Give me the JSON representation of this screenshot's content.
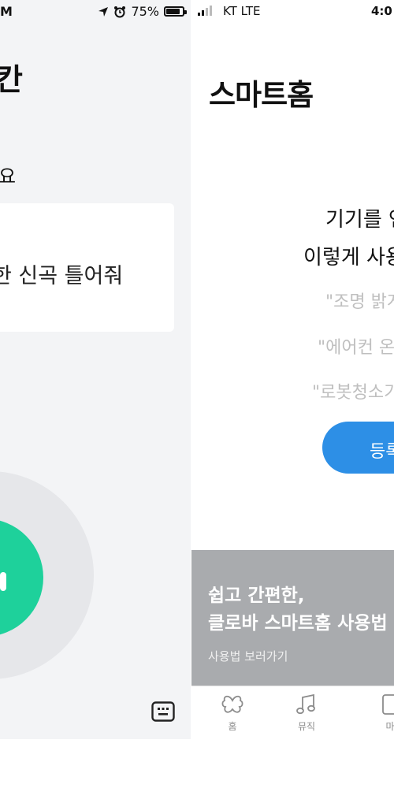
{
  "left": {
    "status": {
      "time_tail": "M",
      "battery_text": "75%",
      "battery_level": 0.75
    },
    "title_fragment": "칸",
    "subtitle_fragment": "요",
    "request_text": "한 신곡 틀어줘"
  },
  "right": {
    "status": {
      "carrier": "KT  LTE",
      "time": "4:0"
    },
    "title": "스마트홈",
    "guide_line1": "기기를 연",
    "guide_line2": "이렇게 사용",
    "examples": [
      "\"조명 밝게",
      "\"에어컨 온",
      "\"로봇청소기"
    ],
    "register_button": "등록",
    "banner": {
      "line1": "쉽고 간편한,",
      "line2": "클로바 스마트홈 사용법",
      "link": "사용법 보러가기"
    },
    "tabs": [
      {
        "label": "홈",
        "icon": "clover-icon"
      },
      {
        "label": "뮤직",
        "icon": "music-note-icon"
      },
      {
        "label": "마",
        "icon": "device-icon"
      }
    ]
  }
}
